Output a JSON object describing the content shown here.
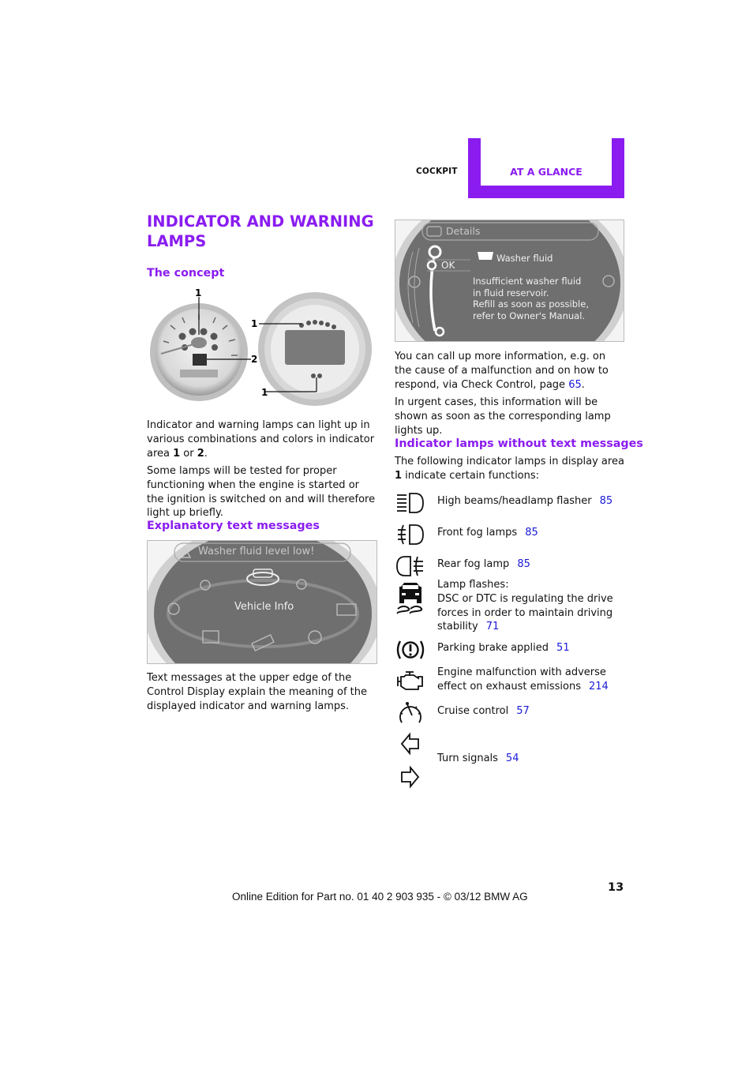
{
  "header": {
    "section": "COCKPIT",
    "tab": "AT A GLANCE"
  },
  "title": "INDICATOR AND WARNING LAMPS",
  "concept": {
    "heading": "The concept",
    "figure": {
      "callouts": [
        "1",
        "1",
        "1",
        "2"
      ]
    },
    "para1_pre": "Indicator and warning lamps can light up in various combinations and colors in indicator area ",
    "para1_b1": "1",
    "para1_mid": " or ",
    "para1_b2": "2",
    "para1_end": ".",
    "para2": "Some lamps will be tested for proper functioning when the engine is started or the ignition is switched on and will therefore light up briefly."
  },
  "explanatory": {
    "heading": "Explanatory text messages",
    "screen": {
      "message": "Washer fluid level low!",
      "center_label": "Vehicle Info"
    },
    "para": "Text messages at the upper edge of the Control Display explain the meaning of the displayed indicator and warning lamps."
  },
  "details_screen": {
    "header": "Details",
    "ok": "OK",
    "item_title": "Washer fluid",
    "lines": [
      "Insufficient washer fluid",
      "in fluid reservoir.",
      "Refill as soon as possible,",
      "refer to Owner's Manual."
    ]
  },
  "right": {
    "para1_pre": "You can call up more information, e.g. on the cause of a malfunction and on how to respond, via Check Control, page ",
    "para1_link": "65",
    "para1_end": ".",
    "para2": "In urgent cases, this information will be shown as soon as the corresponding lamp lights up.",
    "heading": "Indicator lamps without text messages",
    "para3_pre": "The following indicator lamps in display area ",
    "para3_b": "1",
    "para3_end": " indicate certain functions:"
  },
  "lamps": [
    {
      "icon": "high-beam-icon",
      "text": "High beams/headlamp flasher",
      "page": "85"
    },
    {
      "icon": "front-fog-icon",
      "text": "Front fog lamps",
      "page": "85"
    },
    {
      "icon": "rear-fog-icon",
      "text": "Rear fog lamp",
      "page": "85"
    },
    {
      "icon": "dsc-icon",
      "text": "Lamp flashes:\nDSC or DTC is regulating the drive forces in order to maintain driving stability",
      "page": "71"
    },
    {
      "icon": "parking-brake-icon",
      "text": "Parking brake applied",
      "page": "51"
    },
    {
      "icon": "engine-icon",
      "text": "Engine malfunction with adverse effect on exhaust emissions",
      "page": "214"
    },
    {
      "icon": "cruise-control-icon",
      "text": "Cruise control",
      "page": "57"
    },
    {
      "icon": "turn-signal-icon",
      "text": "Turn signals",
      "page": "54"
    }
  ],
  "footer": {
    "text": "Online Edition for Part no. 01 40 2 903 935 - © 03/12 BMW AG",
    "page_number": "13"
  }
}
